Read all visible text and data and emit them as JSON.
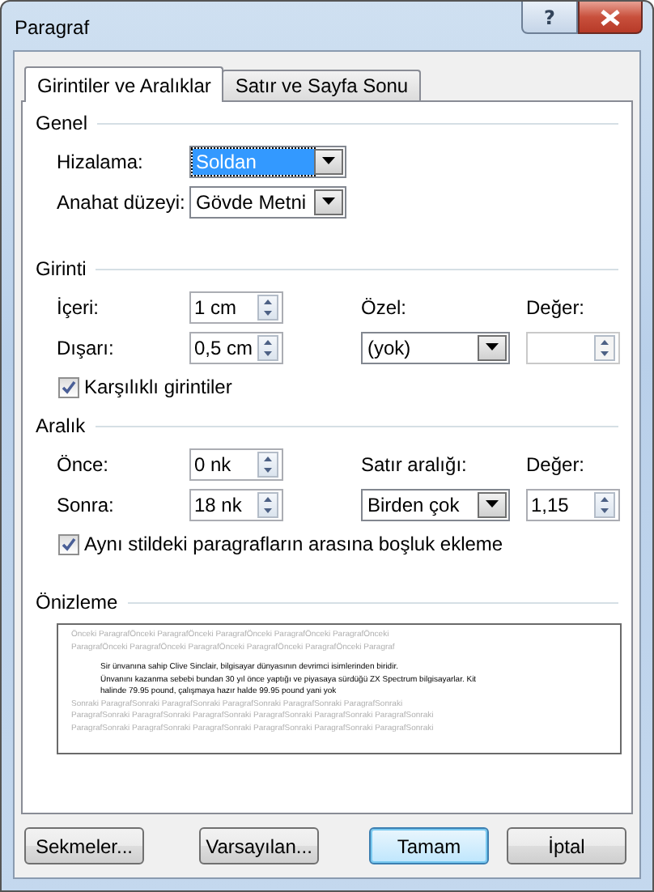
{
  "window": {
    "title": "Paragraf",
    "help_label": "?"
  },
  "tabs": [
    {
      "label": "Girintiler ve Aralıklar",
      "selected": true
    },
    {
      "label": "Satır ve Sayfa Sonu",
      "selected": false
    }
  ],
  "sections": [
    {
      "title": "Genel",
      "rows": [
        {
          "cells": [
            {
              "kind": "label",
              "text": "Hizalama:"
            },
            {
              "kind": "select",
              "value": "Soldan",
              "selected": true
            }
          ]
        },
        {
          "cells": [
            {
              "kind": "label",
              "text": "Anahat düzeyi:"
            },
            {
              "kind": "select",
              "value": "Gövde Metni",
              "selected": false
            }
          ]
        }
      ]
    },
    {
      "title": "Girinti",
      "rows": [
        {
          "cells": [
            {
              "kind": "label",
              "text": "İçeri:"
            },
            {
              "kind": "spinner",
              "value": "1 cm"
            },
            {
              "kind": "label",
              "text": "Özel:"
            },
            {
              "kind": "label",
              "text": "Değer:"
            }
          ]
        },
        {
          "cells": [
            {
              "kind": "label",
              "text": "Dışarı:"
            },
            {
              "kind": "spinner",
              "value": "0,5 cm"
            },
            {
              "kind": "select",
              "value": "(yok)",
              "selected": false
            },
            {
              "kind": "spinner",
              "disabled": true
            }
          ]
        }
      ],
      "checkbox": {
        "label": "Karşılıklı girintiler",
        "checked": true
      }
    },
    {
      "title": "Aralık",
      "rows": [
        {
          "cells": [
            {
              "kind": "label",
              "text": "Önce:"
            },
            {
              "kind": "spinner",
              "value": "0 nk"
            },
            {
              "kind": "label",
              "text": "Satır aralığı:"
            },
            {
              "kind": "label",
              "text": "Değer:"
            }
          ]
        },
        {
          "cells": [
            {
              "kind": "label",
              "text": "Sonra:"
            },
            {
              "kind": "spinner",
              "value": "18 nk"
            },
            {
              "kind": "select",
              "value": "Birden çok",
              "selected": false
            },
            {
              "kind": "spinner",
              "value": "1,15",
              "disabled": false
            }
          ]
        }
      ],
      "checkbox": {
        "label": "Aynı stildeki paragrafların arasına boşluk ekleme",
        "checked": true
      }
    }
  ],
  "preview": {
    "title": "Önizleme",
    "before": [
      "Önceki ParagrafÖnceki ParagrafÖnceki ParagrafÖnceki ParagrafÖnceki ParagrafÖnceki",
      "ParagrafÖnceki ParagrafÖnceki ParagrafÖnceki ParagrafÖnceki ParagrafÖnceki Paragraf"
    ],
    "sample": [
      "Sir ünvanına sahip Clive Sinclair, bilgisayar dünyasının devrimci isimlerinden biridir.",
      "Ünvanını kazanma sebebi bundan 30 yıl önce yaptığı ve piyasaya sürdüğü ZX Spectrum bilgisayarlar. Kit",
      "halinde 79.95 pound, çalışmaya hazır halde 99.95 pound yani yok"
    ],
    "after": [
      "Sonraki ParagrafSonraki ParagrafSonraki ParagrafSonraki ParagrafSonraki ParagrafSonraki",
      "ParagrafSonraki ParagrafSonraki ParagrafSonraki ParagrafSonraki ParagrafSonraki ParagrafSonraki",
      "ParagrafSonraki ParagrafSonraki ParagrafSonraki ParagrafSonraki ParagrafSonraki ParagrafSonraki"
    ]
  },
  "buttons": [
    {
      "label": "Sekmeler...",
      "default": false
    },
    {
      "label": "Varsayılan...",
      "default": false
    },
    {
      "label": "Tamam",
      "default": true
    },
    {
      "label": "İptal",
      "default": false
    }
  ]
}
